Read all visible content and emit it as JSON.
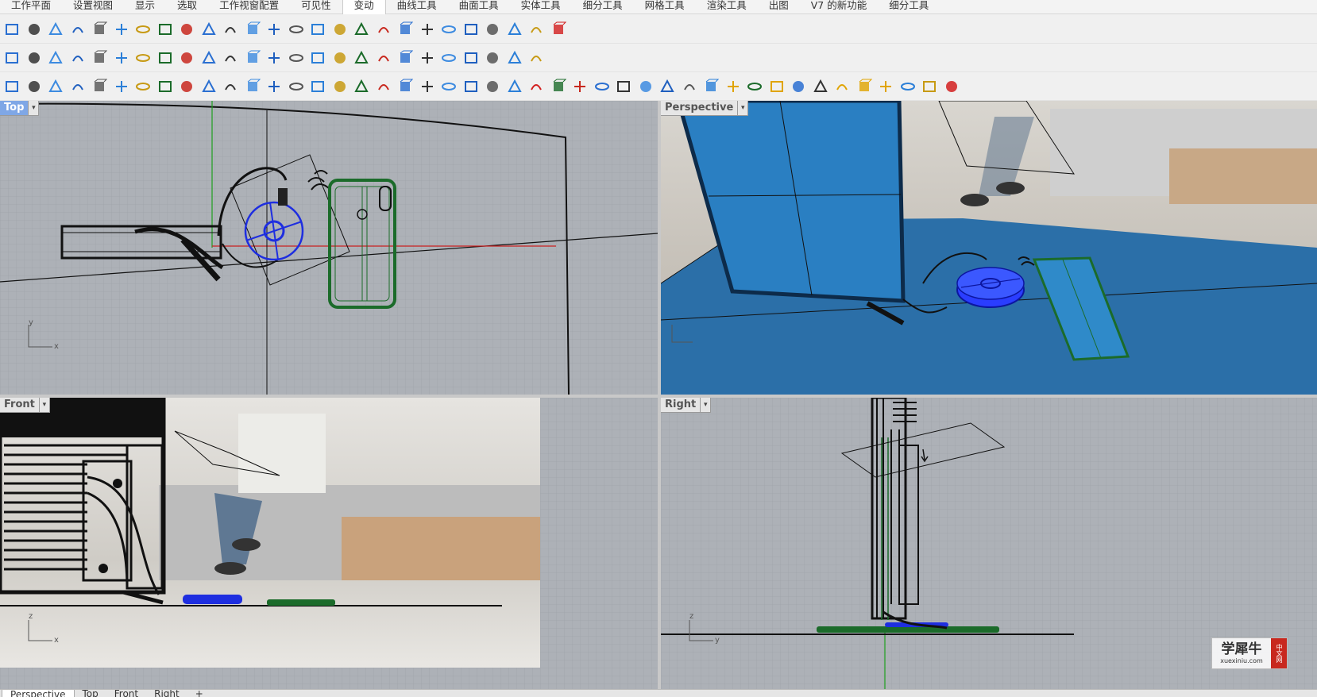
{
  "menu": {
    "tabs": [
      "工作平面",
      "设置视图",
      "显示",
      "选取",
      "工作视窗配置",
      "可见性",
      "变动",
      "曲线工具",
      "曲面工具",
      "实体工具",
      "细分工具",
      "网格工具",
      "渲染工具",
      "出图",
      "V7 的新功能",
      "细分工具"
    ],
    "active_tab": "变动"
  },
  "toolbar1": [
    "text-icon",
    "group-icon",
    "edit-icon",
    "box-icon",
    "array-icon",
    "surface-icon",
    "point-icon",
    "curve-edit-icon",
    "control-point-icon",
    "trim-icon",
    "grid-points-icon",
    "scale-icon",
    "move-icon",
    "array-path-icon",
    "dimension-icon",
    "mirror-icon",
    "offset-icon",
    "sweep-icon",
    "loft-icon",
    "blend-icon",
    "wave-icon",
    "shear-icon",
    "flow-icon",
    "table-icon",
    "car-icon",
    "arrow-red-icon"
  ],
  "toolbar2": [
    "rotate-view-icon",
    "rotate-icon",
    "cloud-icon",
    "viewport-icon",
    "window-icon",
    "layout-icon",
    "funnel-icon",
    "circle-icon",
    "ramp-icon",
    "lamp-icon",
    "sparkle-icon",
    "dome-icon",
    "hexagon-icon",
    "sun-icon",
    "stripes-icon",
    "car-roof-icon",
    "cube-outline-icon",
    "box-view-icon",
    "grass-icon",
    "leaf-icon",
    "panel-icon",
    "earth-icon",
    "line-pair-icon",
    "globe-grid-icon",
    "camera-box-icon"
  ],
  "toolbar3": [
    "drop-icon",
    "cone-icon",
    "cylinder-icon",
    "sphere-icon",
    "ellipsoid-icon",
    "torus-icon",
    "box-solid-icon",
    "pipe-icon",
    "helix-icon",
    "tripod-icon",
    "bend-icon",
    "twist-icon",
    "cage-icon",
    "ribbon-icon",
    "cube-blue-icon",
    "cube-dark-icon",
    "chain-icon",
    "mesh-plane-icon",
    "link-icon",
    "grid-blue-icon",
    "mesh-sphere-icon",
    "mesh-box-icon",
    "bucket-icon",
    "bench-icon",
    "numbered-icon",
    "cut-icon",
    "eraser-icon",
    "stack-icon",
    "roller-icon",
    "cube-pattern-icon",
    "list-icon",
    "scissors-icon",
    "multi-icon",
    "gold-cube-icon",
    "pen-icon",
    "gold-globe-icon",
    "hammer-icon",
    "brush-icon",
    "gold-box-icon",
    "gold-sphere-icon",
    "gold-cube2-icon",
    "no-icon",
    "funnel2-icon",
    "red-heart-icon"
  ],
  "viewports": {
    "top": {
      "name": "Top",
      "axis_x": "x",
      "axis_y": "y"
    },
    "perspective": {
      "name": "Perspective"
    },
    "front": {
      "name": "Front",
      "axis_x": "x",
      "axis_y": "z"
    },
    "right": {
      "name": "Right",
      "axis_x": "y",
      "axis_y": "z"
    }
  },
  "bottom_tabs": [
    "Perspective",
    "Top",
    "Front",
    "Right",
    "+"
  ],
  "bottom_active": "Perspective",
  "watermark": {
    "title": "学犀牛",
    "url": "xuexiniu.com",
    "seal": "中文网"
  },
  "colors": {
    "grid_bg": "#a9adb3",
    "grid_line": "#9a9ea4",
    "phone": "#1b6b2a",
    "charger": "#1e2ee0",
    "persp_blue": "#2a7fc2",
    "active_label": "#7fa7e6"
  }
}
